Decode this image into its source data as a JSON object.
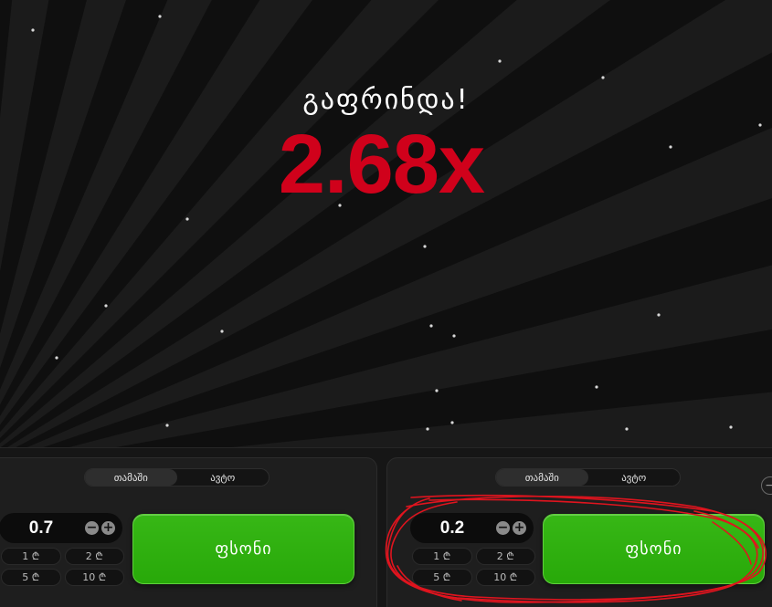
{
  "game": {
    "status": "გაფრინდა!",
    "multiplier": "2.68x",
    "colors": {
      "multiplier": "#d0011b",
      "background": "#0f0f0f",
      "bet_button": "#2aab0a",
      "annotation": "#e0141e"
    }
  },
  "panels": [
    {
      "tabs": [
        {
          "label": "თამაში",
          "active": true
        },
        {
          "label": "ავტო",
          "active": false
        }
      ],
      "amount": "0.7",
      "minus": "−",
      "plus": "+",
      "quick_bets": [
        "1 ₾",
        "2 ₾",
        "5 ₾",
        "10 ₾"
      ],
      "bet_label": "ფსონი"
    },
    {
      "tabs": [
        {
          "label": "თამაში",
          "active": true
        },
        {
          "label": "ავტო",
          "active": false
        }
      ],
      "amount": "0.2",
      "minus": "−",
      "plus": "+",
      "quick_bets": [
        "1 ₾",
        "2 ₾",
        "5 ₾",
        "10 ₾"
      ],
      "bet_label": "ფსონი",
      "remove_icon": "−"
    }
  ]
}
